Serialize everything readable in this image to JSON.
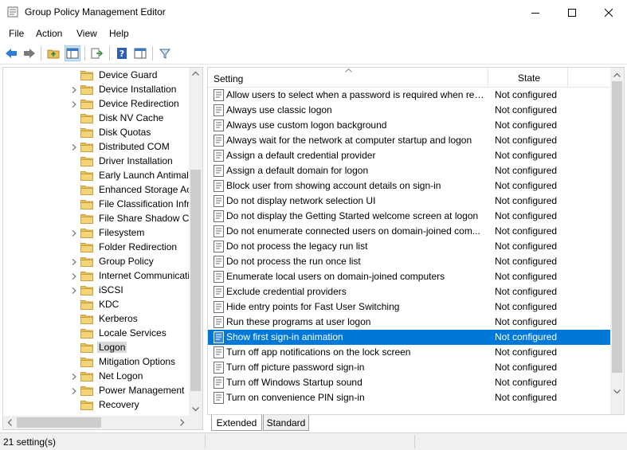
{
  "window": {
    "title": "Group Policy Management Editor"
  },
  "menu": [
    "File",
    "Action",
    "View",
    "Help"
  ],
  "toolbar": {
    "buttons": [
      "back-icon",
      "forward-icon",
      "up-folder-icon",
      "show-hide-tree-icon",
      "export-list-icon",
      "help-icon",
      "console-pane-icon",
      "filter-icon"
    ]
  },
  "tree": {
    "items": [
      {
        "label": "Device Guard",
        "expandable": false
      },
      {
        "label": "Device Installation",
        "expandable": true
      },
      {
        "label": "Device Redirection",
        "expandable": true
      },
      {
        "label": "Disk NV Cache",
        "expandable": false
      },
      {
        "label": "Disk Quotas",
        "expandable": false
      },
      {
        "label": "Distributed COM",
        "expandable": true
      },
      {
        "label": "Driver Installation",
        "expandable": false
      },
      {
        "label": "Early Launch Antimalw",
        "expandable": false
      },
      {
        "label": "Enhanced Storage Acc",
        "expandable": false
      },
      {
        "label": "File Classification Infra",
        "expandable": false
      },
      {
        "label": "File Share Shadow Cop",
        "expandable": false
      },
      {
        "label": "Filesystem",
        "expandable": true
      },
      {
        "label": "Folder Redirection",
        "expandable": false
      },
      {
        "label": "Group Policy",
        "expandable": true
      },
      {
        "label": "Internet Communicatio",
        "expandable": true
      },
      {
        "label": "iSCSI",
        "expandable": true
      },
      {
        "label": "KDC",
        "expandable": false
      },
      {
        "label": "Kerberos",
        "expandable": false
      },
      {
        "label": "Locale Services",
        "expandable": false
      },
      {
        "label": "Logon",
        "expandable": false,
        "selected": true
      },
      {
        "label": "Mitigation Options",
        "expandable": false
      },
      {
        "label": "Net Logon",
        "expandable": true
      },
      {
        "label": "Power Management",
        "expandable": true
      },
      {
        "label": "Recovery",
        "expandable": false
      }
    ]
  },
  "list": {
    "col_setting": "Setting",
    "col_state": "State",
    "rows": [
      {
        "name": "Allow users to select when a password is required when resu...",
        "state": "Not configured"
      },
      {
        "name": "Always use classic logon",
        "state": "Not configured"
      },
      {
        "name": "Always use custom logon background",
        "state": "Not configured"
      },
      {
        "name": "Always wait for the network at computer startup and logon",
        "state": "Not configured"
      },
      {
        "name": "Assign a default credential provider",
        "state": "Not configured"
      },
      {
        "name": "Assign a default domain for logon",
        "state": "Not configured"
      },
      {
        "name": "Block user from showing account details on sign-in",
        "state": "Not configured"
      },
      {
        "name": "Do not display network selection UI",
        "state": "Not configured"
      },
      {
        "name": "Do not display the Getting Started welcome screen at logon",
        "state": "Not configured"
      },
      {
        "name": "Do not enumerate connected users on domain-joined com...",
        "state": "Not configured"
      },
      {
        "name": "Do not process the legacy run list",
        "state": "Not configured"
      },
      {
        "name": "Do not process the run once list",
        "state": "Not configured"
      },
      {
        "name": "Enumerate local users on domain-joined computers",
        "state": "Not configured"
      },
      {
        "name": "Exclude credential providers",
        "state": "Not configured"
      },
      {
        "name": "Hide entry points for Fast User Switching",
        "state": "Not configured"
      },
      {
        "name": "Run these programs at user logon",
        "state": "Not configured"
      },
      {
        "name": "Show first sign-in animation",
        "state": "Not configured",
        "selected": true
      },
      {
        "name": "Turn off app notifications on the lock screen",
        "state": "Not configured"
      },
      {
        "name": "Turn off picture password sign-in",
        "state": "Not configured"
      },
      {
        "name": "Turn off Windows Startup sound",
        "state": "Not configured"
      },
      {
        "name": "Turn on convenience PIN sign-in",
        "state": "Not configured"
      }
    ]
  },
  "tabs": {
    "extended": "Extended",
    "standard": "Standard"
  },
  "status": {
    "text": "21 setting(s)"
  },
  "colors": {
    "selection": "#0078d7",
    "folder": "#e8c15f",
    "tree_selected": "#d9d9d9"
  }
}
